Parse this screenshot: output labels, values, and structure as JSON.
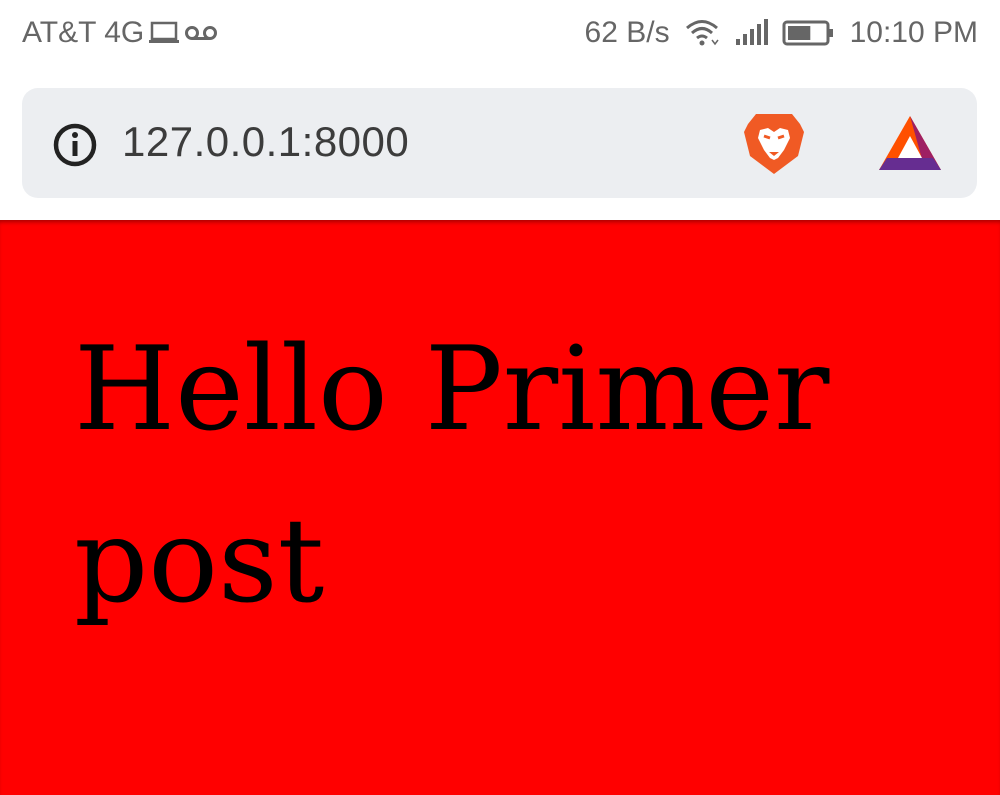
{
  "status_bar": {
    "carrier": "AT&T 4G",
    "net_speed": "62 B/s",
    "time": "10:10 PM",
    "battery_level": 0.62
  },
  "browser": {
    "url": "127.0.0.1:8000",
    "icons": {
      "site_info": "info-icon",
      "brave": "brave-lion-icon",
      "rewards": "bat-triangle-icon"
    }
  },
  "page": {
    "background": "#ff0000",
    "heading": "Hello Primer post"
  }
}
